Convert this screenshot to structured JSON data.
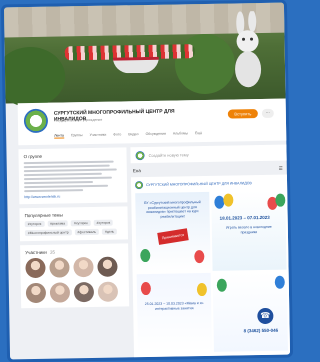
{
  "header": {
    "org_name": "СУРГУТСКИЙ МНОГОПРОФИЛЬНЫЙ ЦЕНТР ДЛЯ ИНВАЛИДОВ",
    "org_subtitle": "Государственное учреждение",
    "join_label": "Вступить",
    "more_label": "...",
    "tabs": [
      "Лента",
      "Группы",
      "Участники",
      "Фото",
      "Видео",
      "Обсуждения",
      "Альбомы",
      "Ещё"
    ]
  },
  "about": {
    "title": "О группе",
    "link": "http://www.smolensk.ru"
  },
  "topics": {
    "title": "Популярные темы",
    "chips": [
      "#хуторок",
      "#реклама",
      "#хуторок",
      "#хуторок",
      "#Многопрофильный центр",
      "#фестиваль",
      "#день"
    ]
  },
  "members": {
    "title": "Участники",
    "count": "35",
    "avatar_colors": [
      "#8a6a5a",
      "#b9a08e",
      "#d2b7a8",
      "#6e5b52",
      "#a28777",
      "#c5a99a",
      "#7c6a63",
      "#d9c3b6"
    ]
  },
  "feed": {
    "composer_placeholder": "Создайте новую тему",
    "section_label": "Ена",
    "post_org": "СУРГУТСКИЙ МНОГОПРОФИЛЬНЫЙ ЦЕНТР ДЛЯ ИНВАЛИДОВ",
    "tile_a_text": "БУ «Сургутский многопрофильный реабилитационный центр для инвалидов» приглашает на курс реабилитации!",
    "tile_a_badge": "Принимаются",
    "tile_b_date": "18.01.2023 – 07.01.2023",
    "tile_b_text": "Играть весело в новогодние праздники",
    "tile_c_text": "25.01.2023 – 10.03.2023 «Мама и я» интерактивные занятия",
    "tile_d_number": "8 (3462) 550-046"
  },
  "colors": {
    "accent": "#ee8208",
    "brand": "#1f5fb0"
  }
}
